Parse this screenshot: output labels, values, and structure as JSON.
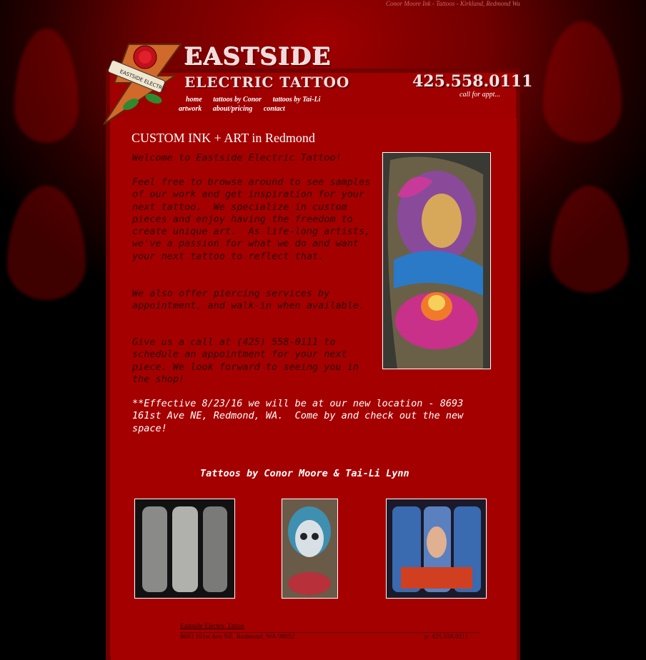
{
  "site": {
    "top_tagline": "Conor Moore Ink - Tattoos - Kirkland, Redmond Wa",
    "brand_top": "EASTSIDE",
    "brand_bottom": "ELECTRIC TATTOO",
    "phone": "425.558.0111",
    "call_note": "call for appt..."
  },
  "nav": {
    "items": [
      {
        "label": "home"
      },
      {
        "label": "tattoos by Conor"
      },
      {
        "label": "tattoos by Tai-Li"
      },
      {
        "label": "artwork"
      },
      {
        "label": "about/pricing"
      },
      {
        "label": "contact"
      }
    ]
  },
  "main": {
    "headline": "CUSTOM INK + ART in Redmond",
    "paragraphs": [
      "Welcome to Eastside Electric Tattoo!",
      "Feel free to browse around to see samples of our work and get inspiration for your next tattoo.  We specialize in custom pieces and enjoy having the freedom to create unique art.  As life-long artists, we've a passion for what we do and want your next tattoo to reflect that.",
      "We also offer piercing services by appointment, and walk-in when available.",
      "Give us a call at (425) 558-0111 to schedule an appointment for your next piece. We look forward to seeing you in the shop!",
      "**Effective 8/23/16 we will be at our new location - 8693 161st Ave NE, Redmond, WA.  Come by and check out the new space!"
    ],
    "gallery_title": "Tattoos by Conor Moore & Tai-Li Lynn"
  },
  "footer": {
    "name": "Eastside Electric Tattoo",
    "address": "8693 161st Ave NE, Redmond, WA 98052",
    "phone": "p: 425.558.0111"
  },
  "colors": {
    "background": "#8b0000",
    "panel": "#a50000",
    "text_dark": "#2e0000",
    "text_light": "#ffffff"
  }
}
